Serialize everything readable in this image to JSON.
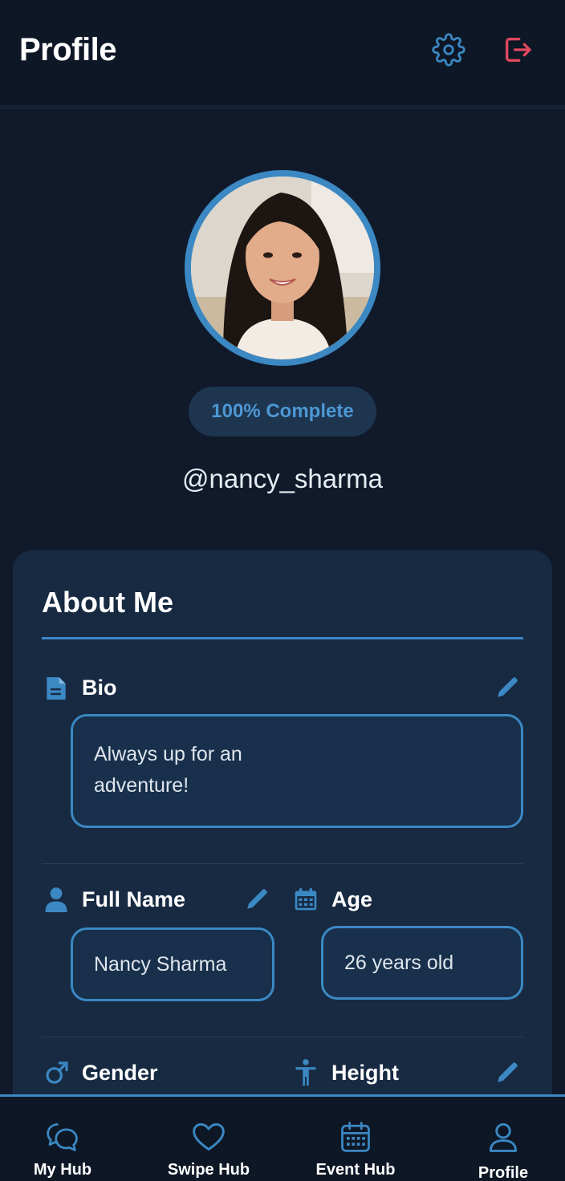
{
  "header": {
    "title": "Profile",
    "settings_icon": "gear-icon",
    "logout_icon": "logout-icon"
  },
  "profile": {
    "completion": "100% Complete",
    "username": "@nancy_sharma"
  },
  "about": {
    "title": "About Me",
    "bio": {
      "label": "Bio",
      "icon": "document-icon",
      "value": "Always up for an adventure!"
    },
    "full_name": {
      "label": "Full Name",
      "icon": "person-icon",
      "value": "Nancy Sharma"
    },
    "age": {
      "label": "Age",
      "icon": "calendar-icon",
      "value": "26 years old"
    },
    "gender": {
      "label": "Gender",
      "icon": "male-icon"
    },
    "height": {
      "label": "Height",
      "icon": "accessibility-icon"
    }
  },
  "nav": {
    "items": [
      {
        "label": "My Hub",
        "icon": "chat-bubbles-icon"
      },
      {
        "label": "Swipe Hub",
        "icon": "heart-icon"
      },
      {
        "label": "Event Hub",
        "icon": "calendar-icon"
      },
      {
        "label": "Profile",
        "icon": "person-outline-icon",
        "active": true
      }
    ]
  },
  "colors": {
    "background": "#101a2b",
    "card": "#172a42",
    "accent": "#3b88c3",
    "logout": "#e0485e"
  }
}
